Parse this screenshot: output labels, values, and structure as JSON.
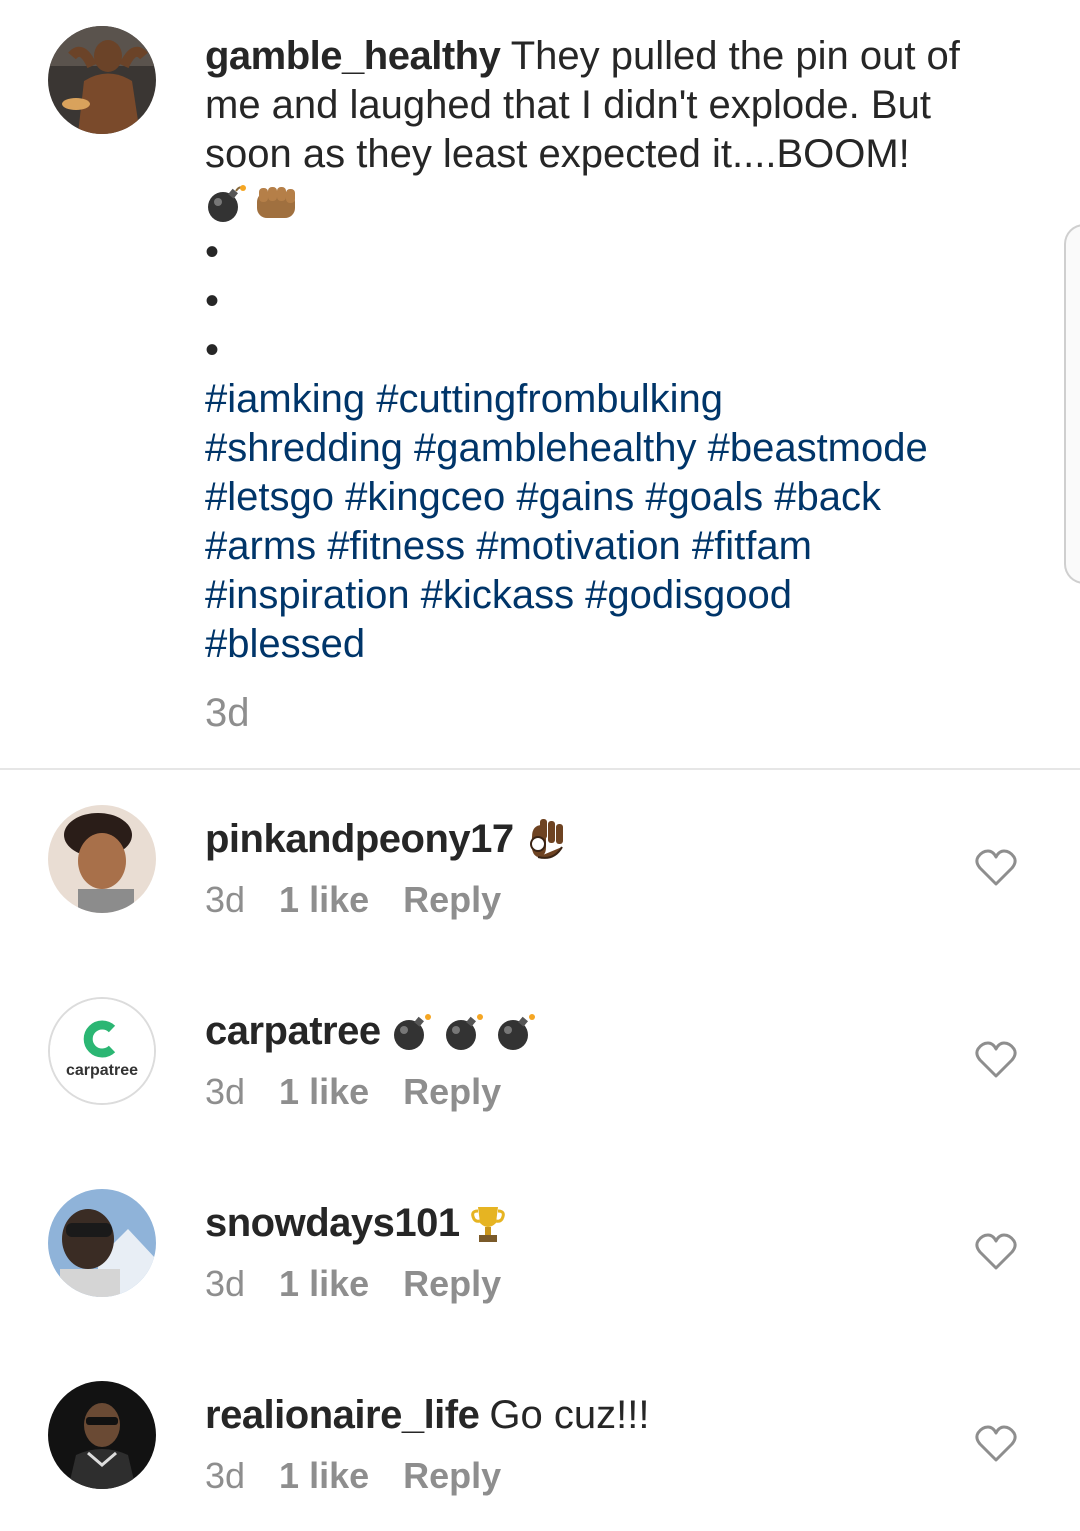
{
  "post": {
    "username": "gamble_healthy",
    "text": "They pulled the pin out of me and laughed that I didn't explode. But soon as they least expected it....BOOM!",
    "line1": "They pulled the pin out of",
    "line2": "me and laughed that I didn't explode. But",
    "line3": "soon as they least expected it....BOOM!",
    "emojis": [
      "bomb-icon",
      "fist-icon"
    ],
    "dots": [
      "•",
      "•",
      "•"
    ],
    "hashtag_lines": [
      "#iamking #cuttingfrombulking",
      "#shredding #gamblehealthy #beastmode",
      "#letsgo #kingceo #gains #goals #back",
      "#arms #fitness #motivation #fitfam",
      "#inspiration #kickass #godisgood",
      "#blessed"
    ],
    "time": "3d"
  },
  "comments": [
    {
      "username": "pinkandpeony17",
      "text": "",
      "emoji": "ok-hand-icon",
      "time": "3d",
      "likes": "1 like",
      "reply": "Reply"
    },
    {
      "username": "carpatree",
      "text": "",
      "emoji": "bomb-icon x3",
      "time": "3d",
      "likes": "1 like",
      "reply": "Reply",
      "avatar_text": "carpatree"
    },
    {
      "username": "snowdays101",
      "text": "",
      "emoji": "trophy-icon",
      "time": "3d",
      "likes": "1 like",
      "reply": "Reply"
    },
    {
      "username": "realionaire_life",
      "text": "Go cuz!!!",
      "time": "3d",
      "likes": "1 like",
      "reply": "Reply"
    }
  ],
  "colors": {
    "text": "#262626",
    "hashtag": "#003569",
    "meta": "#8e8e8e",
    "divider": "#e6e6e6",
    "carpatree_green": "#2bb673"
  }
}
